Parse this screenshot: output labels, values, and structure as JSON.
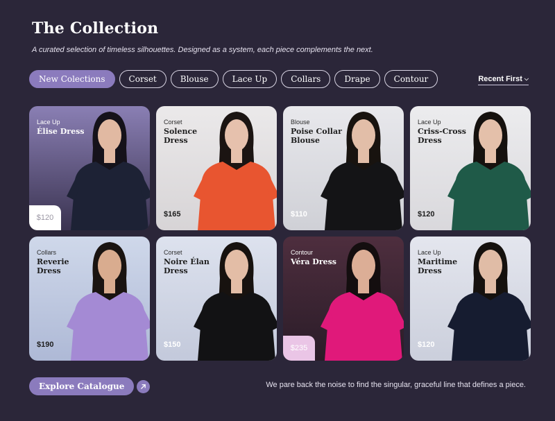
{
  "header": {
    "title": "The Collection",
    "subtitle": "A curated selection of timeless silhouettes. Designed as a system, each piece complements the next."
  },
  "filters": [
    {
      "label": "New Colections",
      "active": true
    },
    {
      "label": "Corset",
      "active": false
    },
    {
      "label": "Blouse",
      "active": false
    },
    {
      "label": "Lace Up",
      "active": false
    },
    {
      "label": "Collars",
      "active": false
    },
    {
      "label": "Drape",
      "active": false
    },
    {
      "label": "Contour",
      "active": false
    }
  ],
  "sort": {
    "label": "Recent First"
  },
  "products": [
    {
      "category": "Lace Up",
      "name": "Élise Dress",
      "price": "$120",
      "bg": [
        "#8a7fb4",
        "#3a3350"
      ],
      "garment": "#1d2235",
      "skin": "#e1b9a2",
      "hair": "#15121a",
      "style": "dark"
    },
    {
      "category": "Corset",
      "name": "Solence Dress",
      "price": "$165",
      "bg": [
        "#ebe9ea",
        "#d7d4d6"
      ],
      "garment": "#e85530",
      "skin": "#e6c1ad",
      "hair": "#1b1412",
      "style": "light"
    },
    {
      "category": "Blouse",
      "name": "Poise Collar Blouse",
      "price": "$110",
      "bg": [
        "#e8e8ec",
        "#cfd0d6"
      ],
      "garment": "#141416",
      "skin": "#e2bea8",
      "hair": "#18130f",
      "style": "light"
    },
    {
      "category": "Lace Up",
      "name": "Criss-Cross Dress",
      "price": "$120",
      "bg": [
        "#ececee",
        "#d9d8dc"
      ],
      "garment": "#1f5a48",
      "skin": "#e4c0aa",
      "hair": "#15110e",
      "style": "light"
    },
    {
      "category": "Collars",
      "name": "Reverie Dress",
      "price": "$190",
      "bg": [
        "#cfd8ea",
        "#aeb9d6"
      ],
      "garment": "#a48ad4",
      "skin": "#d9ac8f",
      "hair": "#1a1411",
      "style": "light"
    },
    {
      "category": "Corset",
      "name": "Noire Élan Dress",
      "price": "$150",
      "bg": [
        "#dde2ee",
        "#c3c9db"
      ],
      "garment": "#121214",
      "skin": "#e3bda6",
      "hair": "#17120f",
      "style": "light"
    },
    {
      "category": "Contour",
      "name": "Véra Dress",
      "price": "$235",
      "bg": [
        "#4e2e3e",
        "#2a1c28"
      ],
      "garment": "#e0197a",
      "skin": "#dcae96",
      "hair": "#140e0f",
      "style": "dark"
    },
    {
      "category": "Lace Up",
      "name": "Maritime Dress",
      "price": "$120",
      "bg": [
        "#e4e6ee",
        "#cbcfdc"
      ],
      "garment": "#161c30",
      "skin": "#e0bca6",
      "hair": "#15110e",
      "style": "light"
    }
  ],
  "footer": {
    "explore_label": "Explore Catalogue",
    "tagline": "We pare back the noise to find the singular, graceful line that defines a piece."
  }
}
